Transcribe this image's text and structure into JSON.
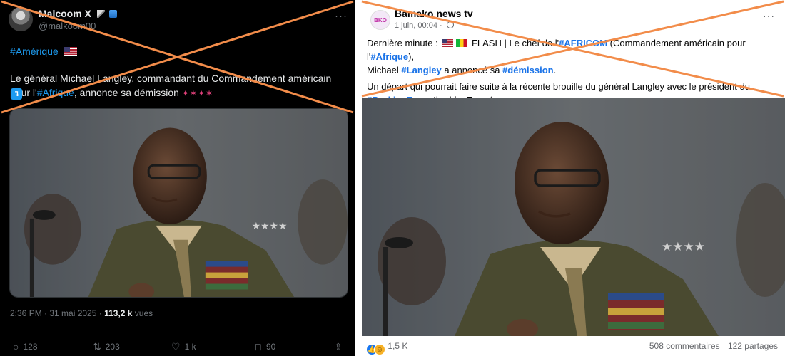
{
  "twitter_post": {
    "user_name": "Malcoom X",
    "handle": "@malkoom00",
    "hashtag": "#Amérique",
    "text_before_link": "Le général Michael Langley, commandant du Commandement américain pour l'",
    "text_link": "#Afrique",
    "text_after_link": ", annonce sa démission",
    "timestamp": "2:36 PM · 31 mai 2025 · ",
    "views": "113,2 k",
    "views_label": " vues",
    "replies": "128",
    "reposts": "203",
    "likes": "1 k",
    "bookmarks": "90",
    "icons": [
      "reply-icon",
      "repost-icon",
      "like-icon",
      "bookmark-icon",
      "share-icon"
    ]
  },
  "facebook_post": {
    "page_name": "Bamako news tv",
    "time": "1 juin, 00:04 · ",
    "logo_text": "BKO",
    "p1_a": "Dernière minute : ",
    "p1_b": " FLASH | Le chef de l'",
    "p1_link1": "#AFRICOM",
    "p1_c": " (Commandement américain pour l'",
    "p1_link2": "#Afrique",
    "p1_d": "),",
    "p1_e": "Michael ",
    "p1_link3": "#Langley",
    "p1_f": " a annoncé sa ",
    "p1_link4": "#démission",
    "p1_g": ".",
    "p2_a": "Un départ qui pourrait faire suite à la récente brouille du général Langley avec le président du",
    "p2_link": "#BurkinaFaso",
    "p2_b": ", Ibrahim Traoré.",
    "reactions_count": "1,5 K",
    "comments": "508 commentaires",
    "shares": "122 partages"
  },
  "colors": {
    "cross_out": "#f28c4a",
    "twitter_link": "#1d9bf0",
    "facebook_link": "#1a73e8"
  }
}
